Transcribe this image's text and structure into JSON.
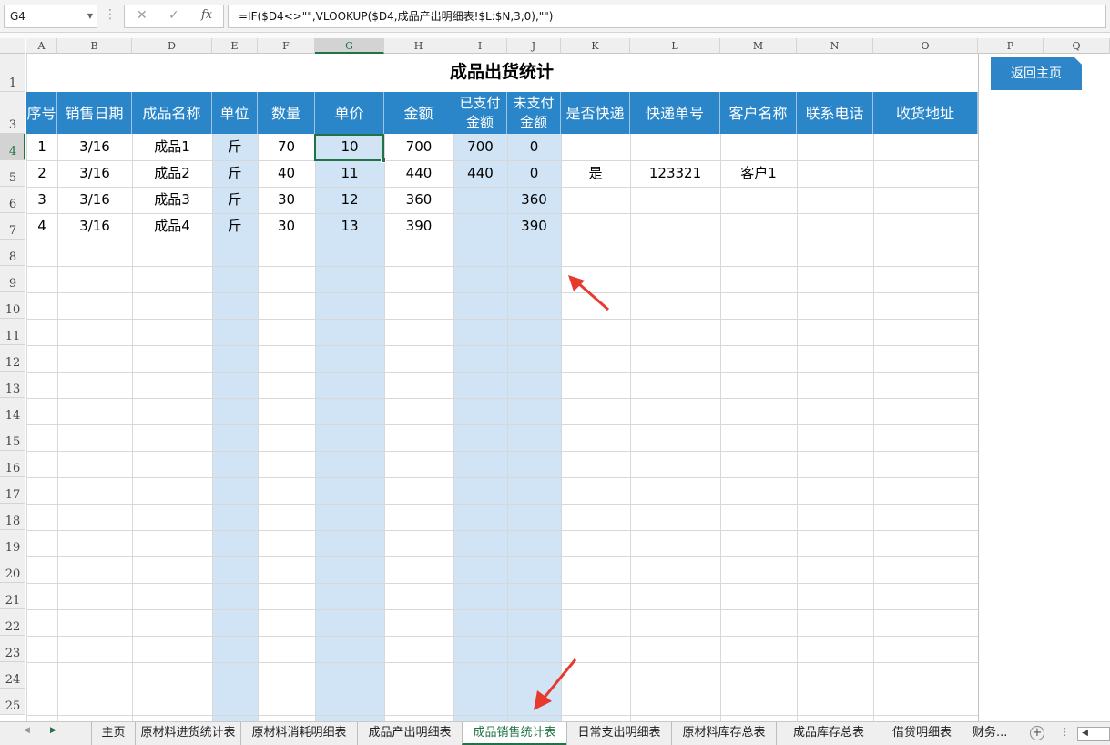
{
  "formula_bar": {
    "name_box": "G4",
    "formula": "=IF($D4<>\"\",VLOOKUP($D4,成品产出明细表!$L:$N,3,0),\"\")",
    "cancel_icon": "✕",
    "enter_icon": "✓",
    "fx_label": "fx"
  },
  "columns": [
    {
      "letter": "A"
    },
    {
      "letter": "B"
    },
    {
      "letter": "D"
    },
    {
      "letter": "E"
    },
    {
      "letter": "F"
    },
    {
      "letter": "G"
    },
    {
      "letter": "H"
    },
    {
      "letter": "I"
    },
    {
      "letter": "J"
    },
    {
      "letter": "K"
    },
    {
      "letter": "L"
    },
    {
      "letter": "M"
    },
    {
      "letter": "N"
    },
    {
      "letter": "O"
    },
    {
      "letter": "P"
    },
    {
      "letter": "Q"
    }
  ],
  "rows": [
    "1",
    "3",
    "4",
    "5",
    "6",
    "7",
    "8",
    "9",
    "10",
    "11",
    "12",
    "13",
    "14",
    "15",
    "16",
    "17",
    "18",
    "19",
    "20",
    "21",
    "22",
    "23",
    "24",
    "25"
  ],
  "sheet": {
    "title": "成品出货统计",
    "home_button": "返回主页",
    "headers": [
      "序号",
      "销售日期",
      "成品名称",
      "单位",
      "数量",
      "单价",
      "金额",
      "已支付\n金额",
      "未支付\n金额",
      "是否快递",
      "快递单号",
      "客户名称",
      "联系电话",
      "收货地址"
    ],
    "data": [
      [
        "1",
        "3/16",
        "成品1",
        "斤",
        "70",
        "10",
        "700",
        "700",
        "0",
        "",
        "",
        "",
        "",
        ""
      ],
      [
        "2",
        "3/16",
        "成品2",
        "斤",
        "40",
        "11",
        "440",
        "440",
        "0",
        "是",
        "123321",
        "客户1",
        "",
        ""
      ],
      [
        "3",
        "3/16",
        "成品3",
        "斤",
        "30",
        "12",
        "360",
        "",
        "360",
        "",
        "",
        "",
        "",
        ""
      ],
      [
        "4",
        "3/16",
        "成品4",
        "斤",
        "30",
        "13",
        "390",
        "",
        "390",
        "",
        "",
        "",
        "",
        ""
      ]
    ]
  },
  "tabs": [
    "主页",
    "原材料进货统计表",
    "原材料消耗明细表",
    "成品产出明细表",
    "成品销售统计表",
    "日常支出明细表",
    "原材料库存总表",
    "成品库存总表",
    "借贷明细表"
  ],
  "active_tab": "成品销售统计表",
  "tab_more": "财务...",
  "colors": {
    "header_blue": "#2b86c9",
    "highlight_band": "#d0e4f5",
    "excel_green": "#217346",
    "arrow_red": "#e8392f"
  }
}
